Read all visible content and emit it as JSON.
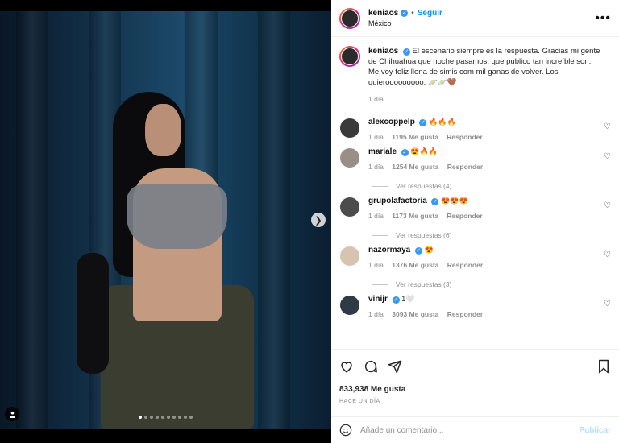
{
  "post": {
    "username": "keniaos",
    "follow_label": "Seguir",
    "location": "México",
    "dot": "•"
  },
  "caption": {
    "username": "keniaos",
    "text": "El escenario siempre es la respuesta. Gracias mi gente de Chihuahua que noche pasamos, que publico tan increíble son. Me voy feliz llena de simis com mil ganas de volver. Los quierooooooooo. 🪐🪐🤎",
    "time": "1 día"
  },
  "comments": [
    {
      "username": "alexcoppelp",
      "text": "🔥🔥🔥",
      "time": "1 día",
      "likes": "1195 Me gusta",
      "reply": "Responder",
      "replies": ""
    },
    {
      "username": "mariale",
      "text": "😍🔥🔥",
      "time": "1 día",
      "likes": "1254 Me gusta",
      "reply": "Responder",
      "replies": "Ver respuestas (4)"
    },
    {
      "username": "grupolafactoria",
      "text": "😍😍😍",
      "time": "1 día",
      "likes": "1173 Me gusta",
      "reply": "Responder",
      "replies": "Ver respuestas (6)"
    },
    {
      "username": "nazormaya",
      "text": "😍",
      "time": "1 día",
      "likes": "1376 Me gusta",
      "reply": "Responder",
      "replies": "Ver respuestas (3)"
    },
    {
      "username": "vinijr",
      "text": "1🤍",
      "time": "1 día",
      "likes": "3093 Me gusta",
      "reply": "Responder",
      "replies": ""
    }
  ],
  "stats": {
    "likes": "833,938 Me gusta",
    "date": "HACE UN DÍA"
  },
  "comment_box": {
    "placeholder": "Añade un comentario...",
    "publish": "Publicar"
  },
  "icons": {
    "more": "more-options-icon",
    "like": "heart-icon",
    "comment": "comment-icon",
    "share": "share-icon",
    "save": "bookmark-icon",
    "emoji": "emoji-icon",
    "next": "chevron-right-icon",
    "tag": "user-tag-icon"
  },
  "carousel": {
    "count": 10,
    "active": 0
  }
}
